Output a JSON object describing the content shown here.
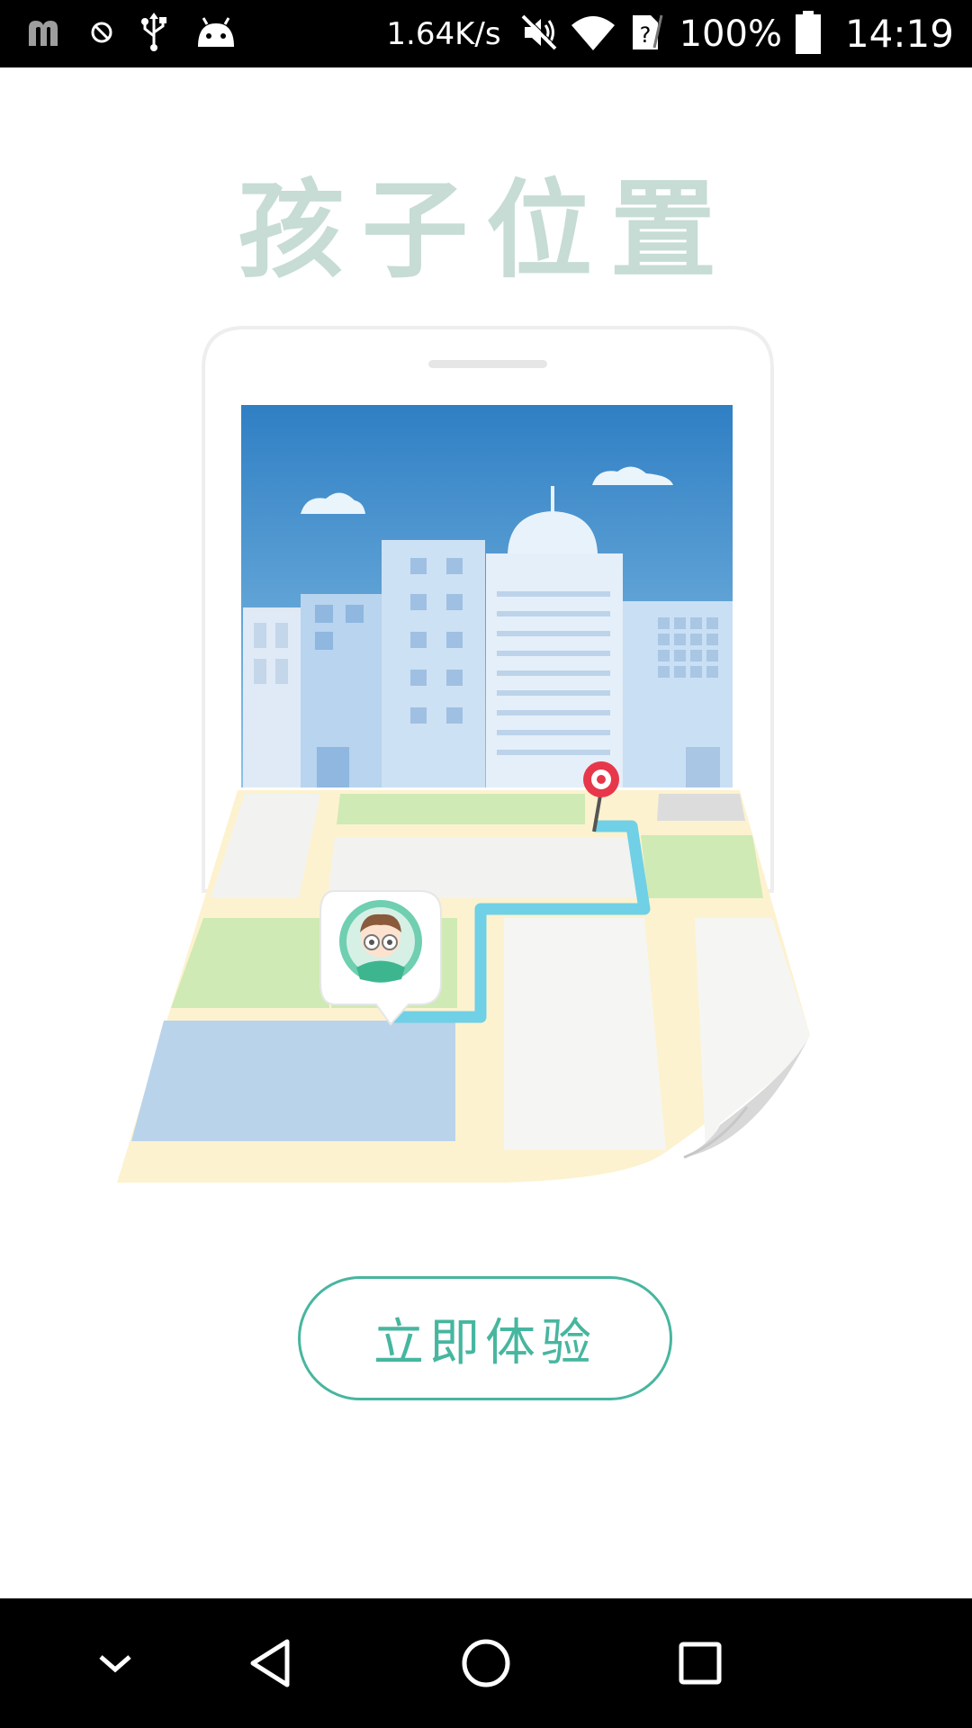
{
  "status_bar": {
    "network_speed": "1.64K/s",
    "battery_percent": "100%",
    "time": "14:19",
    "icons": [
      "app-m-icon",
      "blocked-icon",
      "usb-icon",
      "android-icon",
      "mute-icon",
      "wifi-icon",
      "sim-unknown-icon",
      "battery-icon"
    ]
  },
  "page": {
    "title": "孩子位置",
    "cta_label": "立即体验"
  },
  "nav_bar": {
    "icons": [
      "collapse-chevron-icon",
      "back-triangle-icon",
      "home-circle-icon",
      "recents-square-icon"
    ]
  },
  "colors": {
    "accent": "#47b69f",
    "title": "#c6dcd5",
    "sky_top": "#2f7fc4",
    "sky_bottom": "#8cc3e6",
    "route": "#6fd0e6",
    "pin": "#e8374a"
  }
}
